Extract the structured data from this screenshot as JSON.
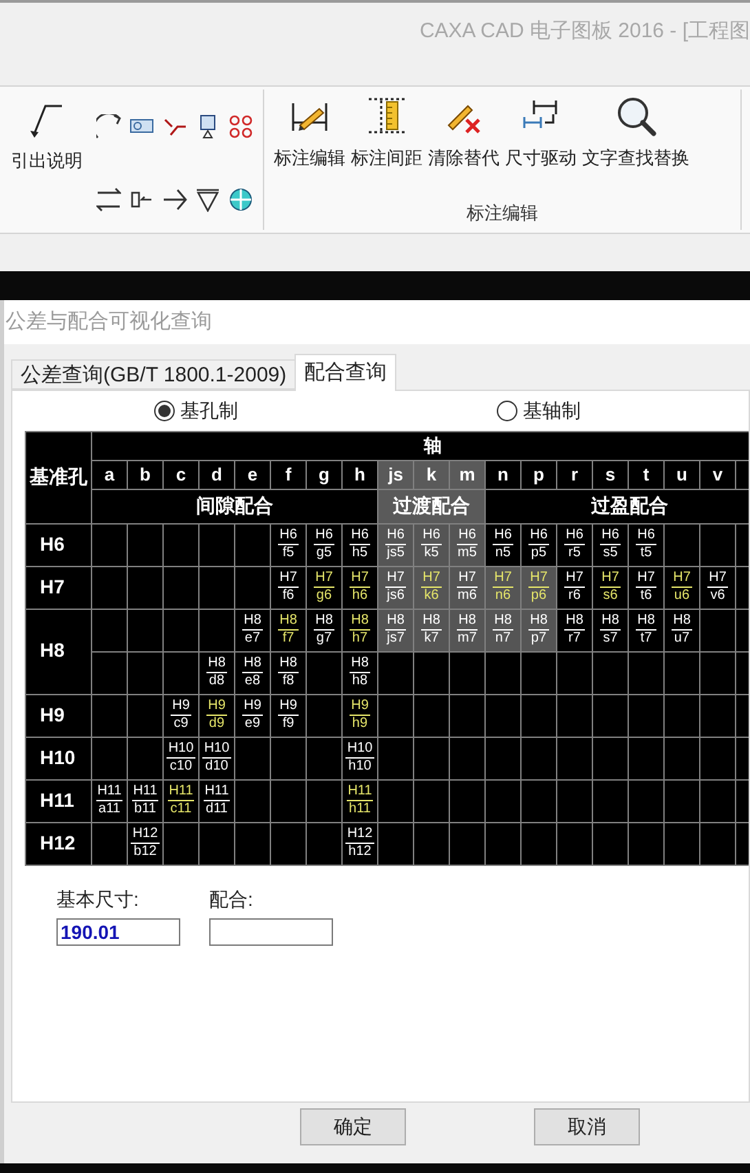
{
  "app_title": "CAXA CAD 电子图板 2016 - [工程图",
  "ribbon": {
    "leader": {
      "label": "引出说明"
    },
    "tools": [
      {
        "label": "标注编辑",
        "kind": "dim-edit"
      },
      {
        "label": "标注间距",
        "kind": "spacing"
      },
      {
        "label": "清除替代",
        "kind": "clear"
      },
      {
        "label": "尺寸驱动",
        "kind": "drive"
      },
      {
        "label": "文字查找替换",
        "kind": "find"
      }
    ],
    "group_label": "标注编辑"
  },
  "dialog": {
    "title": "公差与配合可视化查询",
    "tabs": [
      {
        "label": "公差查询(GB/T 1800.1-2009)",
        "selected": false
      },
      {
        "label": "配合查询",
        "selected": true
      }
    ],
    "radios": [
      {
        "label": "基孔制",
        "selected": true
      },
      {
        "label": "基轴制",
        "selected": false
      }
    ],
    "table": {
      "corner": "基准孔",
      "axis_title": "轴",
      "groups": [
        {
          "label": "间隙配合",
          "shaded": false,
          "columns": [
            "a",
            "b",
            "c",
            "d",
            "e",
            "f",
            "g",
            "h"
          ]
        },
        {
          "label": "过渡配合",
          "shaded": true,
          "columns": [
            "js",
            "k",
            "m"
          ]
        },
        {
          "label": "过盈配合",
          "shaded": false,
          "columns": [
            "n",
            "p",
            "r",
            "s",
            "t",
            "u",
            "v"
          ]
        }
      ],
      "rows": [
        {
          "label": "H6",
          "lines": [
            [
              {
                "kind": "empty"
              },
              {
                "kind": "empty"
              },
              {
                "kind": "empty"
              },
              {
                "kind": "empty"
              },
              {
                "kind": "empty"
              },
              {
                "kind": "fit",
                "top": "H6",
                "bottom": "f5",
                "preferred": false,
                "shaded": false
              },
              {
                "kind": "fit",
                "top": "H6",
                "bottom": "g5",
                "preferred": false,
                "shaded": false
              },
              {
                "kind": "fit",
                "top": "H6",
                "bottom": "h5",
                "preferred": false,
                "shaded": false
              },
              {
                "kind": "fit",
                "top": "H6",
                "bottom": "js5",
                "preferred": false,
                "shaded": true
              },
              {
                "kind": "fit",
                "top": "H6",
                "bottom": "k5",
                "preferred": false,
                "shaded": true
              },
              {
                "kind": "fit",
                "top": "H6",
                "bottom": "m5",
                "preferred": false,
                "shaded": true
              },
              {
                "kind": "fit",
                "top": "H6",
                "bottom": "n5",
                "preferred": false,
                "shaded": false
              },
              {
                "kind": "fit",
                "top": "H6",
                "bottom": "p5",
                "preferred": false,
                "shaded": false
              },
              {
                "kind": "fit",
                "top": "H6",
                "bottom": "r5",
                "preferred": false,
                "shaded": false
              },
              {
                "kind": "fit",
                "top": "H6",
                "bottom": "s5",
                "preferred": false,
                "shaded": false
              },
              {
                "kind": "fit",
                "top": "H6",
                "bottom": "t5",
                "preferred": false,
                "shaded": false
              },
              {
                "kind": "empty"
              },
              {
                "kind": "empty"
              }
            ]
          ]
        },
        {
          "label": "H7",
          "lines": [
            [
              {
                "kind": "empty"
              },
              {
                "kind": "empty"
              },
              {
                "kind": "empty"
              },
              {
                "kind": "empty"
              },
              {
                "kind": "empty"
              },
              {
                "kind": "fit",
                "top": "H7",
                "bottom": "f6",
                "preferred": false,
                "shaded": false
              },
              {
                "kind": "fit",
                "top": "H7",
                "bottom": "g6",
                "preferred": true,
                "shaded": false
              },
              {
                "kind": "fit",
                "top": "H7",
                "bottom": "h6",
                "preferred": true,
                "shaded": false
              },
              {
                "kind": "fit",
                "top": "H7",
                "bottom": "js6",
                "preferred": false,
                "shaded": true
              },
              {
                "kind": "fit",
                "top": "H7",
                "bottom": "k6",
                "preferred": true,
                "shaded": true
              },
              {
                "kind": "fit",
                "top": "H7",
                "bottom": "m6",
                "preferred": false,
                "shaded": true
              },
              {
                "kind": "fit",
                "top": "H7",
                "bottom": "n6",
                "preferred": true,
                "shaded": true
              },
              {
                "kind": "fit",
                "top": "H7",
                "bottom": "p6",
                "preferred": true,
                "shaded": true
              },
              {
                "kind": "fit",
                "top": "H7",
                "bottom": "r6",
                "preferred": false,
                "shaded": false
              },
              {
                "kind": "fit",
                "top": "H7",
                "bottom": "s6",
                "preferred": true,
                "shaded": false
              },
              {
                "kind": "fit",
                "top": "H7",
                "bottom": "t6",
                "preferred": false,
                "shaded": false
              },
              {
                "kind": "fit",
                "top": "H7",
                "bottom": "u6",
                "preferred": true,
                "shaded": false
              },
              {
                "kind": "fit",
                "top": "H7",
                "bottom": "v6",
                "preferred": false,
                "shaded": false
              }
            ]
          ]
        },
        {
          "label": "H8",
          "lines": [
            [
              {
                "kind": "empty"
              },
              {
                "kind": "empty"
              },
              {
                "kind": "empty"
              },
              {
                "kind": "empty"
              },
              {
                "kind": "fit",
                "top": "H8",
                "bottom": "e7",
                "preferred": false,
                "shaded": false
              },
              {
                "kind": "fit",
                "top": "H8",
                "bottom": "f7",
                "preferred": true,
                "shaded": false
              },
              {
                "kind": "fit",
                "top": "H8",
                "bottom": "g7",
                "preferred": false,
                "shaded": false
              },
              {
                "kind": "fit",
                "top": "H8",
                "bottom": "h7",
                "preferred": true,
                "shaded": false
              },
              {
                "kind": "fit",
                "top": "H8",
                "bottom": "js7",
                "preferred": false,
                "shaded": true
              },
              {
                "kind": "fit",
                "top": "H8",
                "bottom": "k7",
                "preferred": false,
                "shaded": true
              },
              {
                "kind": "fit",
                "top": "H8",
                "bottom": "m7",
                "preferred": false,
                "shaded": true
              },
              {
                "kind": "fit",
                "top": "H8",
                "bottom": "n7",
                "preferred": false,
                "shaded": true
              },
              {
                "kind": "fit",
                "top": "H8",
                "bottom": "p7",
                "preferred": false,
                "shaded": true
              },
              {
                "kind": "fit",
                "top": "H8",
                "bottom": "r7",
                "preferred": false,
                "shaded": false
              },
              {
                "kind": "fit",
                "top": "H8",
                "bottom": "s7",
                "preferred": false,
                "shaded": false
              },
              {
                "kind": "fit",
                "top": "H8",
                "bottom": "t7",
                "preferred": false,
                "shaded": false
              },
              {
                "kind": "fit",
                "top": "H8",
                "bottom": "u7",
                "preferred": false,
                "shaded": false
              },
              {
                "kind": "empty"
              }
            ],
            [
              {
                "kind": "empty"
              },
              {
                "kind": "empty"
              },
              {
                "kind": "empty"
              },
              {
                "kind": "fit",
                "top": "H8",
                "bottom": "d8",
                "preferred": false,
                "shaded": false
              },
              {
                "kind": "fit",
                "top": "H8",
                "bottom": "e8",
                "preferred": false,
                "shaded": false
              },
              {
                "kind": "fit",
                "top": "H8",
                "bottom": "f8",
                "preferred": false,
                "shaded": false
              },
              {
                "kind": "empty"
              },
              {
                "kind": "fit",
                "top": "H8",
                "bottom": "h8",
                "preferred": false,
                "shaded": false
              },
              {
                "kind": "empty"
              },
              {
                "kind": "empty"
              },
              {
                "kind": "empty"
              },
              {
                "kind": "empty"
              },
              {
                "kind": "empty"
              },
              {
                "kind": "empty"
              },
              {
                "kind": "empty"
              },
              {
                "kind": "empty"
              },
              {
                "kind": "empty"
              },
              {
                "kind": "empty"
              }
            ]
          ]
        },
        {
          "label": "H9",
          "lines": [
            [
              {
                "kind": "empty"
              },
              {
                "kind": "empty"
              },
              {
                "kind": "fit",
                "top": "H9",
                "bottom": "c9",
                "preferred": false,
                "shaded": false
              },
              {
                "kind": "fit",
                "top": "H9",
                "bottom": "d9",
                "preferred": true,
                "shaded": false
              },
              {
                "kind": "fit",
                "top": "H9",
                "bottom": "e9",
                "preferred": false,
                "shaded": false
              },
              {
                "kind": "fit",
                "top": "H9",
                "bottom": "f9",
                "preferred": false,
                "shaded": false
              },
              {
                "kind": "empty"
              },
              {
                "kind": "fit",
                "top": "H9",
                "bottom": "h9",
                "preferred": true,
                "shaded": false
              },
              {
                "kind": "empty"
              },
              {
                "kind": "empty"
              },
              {
                "kind": "empty"
              },
              {
                "kind": "empty"
              },
              {
                "kind": "empty"
              },
              {
                "kind": "empty"
              },
              {
                "kind": "empty"
              },
              {
                "kind": "empty"
              },
              {
                "kind": "empty"
              },
              {
                "kind": "empty"
              }
            ]
          ]
        },
        {
          "label": "H10",
          "lines": [
            [
              {
                "kind": "empty"
              },
              {
                "kind": "empty"
              },
              {
                "kind": "fit",
                "top": "H10",
                "bottom": "c10",
                "preferred": false,
                "shaded": false
              },
              {
                "kind": "fit",
                "top": "H10",
                "bottom": "d10",
                "preferred": false,
                "shaded": false
              },
              {
                "kind": "empty"
              },
              {
                "kind": "empty"
              },
              {
                "kind": "empty"
              },
              {
                "kind": "fit",
                "top": "H10",
                "bottom": "h10",
                "preferred": false,
                "shaded": false
              },
              {
                "kind": "empty"
              },
              {
                "kind": "empty"
              },
              {
                "kind": "empty"
              },
              {
                "kind": "empty"
              },
              {
                "kind": "empty"
              },
              {
                "kind": "empty"
              },
              {
                "kind": "empty"
              },
              {
                "kind": "empty"
              },
              {
                "kind": "empty"
              },
              {
                "kind": "empty"
              }
            ]
          ]
        },
        {
          "label": "H11",
          "lines": [
            [
              {
                "kind": "fit",
                "top": "H11",
                "bottom": "a11",
                "preferred": false,
                "shaded": false
              },
              {
                "kind": "fit",
                "top": "H11",
                "bottom": "b11",
                "preferred": false,
                "shaded": false
              },
              {
                "kind": "fit",
                "top": "H11",
                "bottom": "c11",
                "preferred": true,
                "shaded": false
              },
              {
                "kind": "fit",
                "top": "H11",
                "bottom": "d11",
                "preferred": false,
                "shaded": false
              },
              {
                "kind": "empty"
              },
              {
                "kind": "empty"
              },
              {
                "kind": "empty"
              },
              {
                "kind": "fit",
                "top": "H11",
                "bottom": "h11",
                "preferred": true,
                "shaded": false
              },
              {
                "kind": "empty"
              },
              {
                "kind": "empty"
              },
              {
                "kind": "empty"
              },
              {
                "kind": "empty"
              },
              {
                "kind": "empty"
              },
              {
                "kind": "empty"
              },
              {
                "kind": "empty"
              },
              {
                "kind": "empty"
              },
              {
                "kind": "empty"
              },
              {
                "kind": "empty"
              }
            ]
          ]
        },
        {
          "label": "H12",
          "lines": [
            [
              {
                "kind": "empty"
              },
              {
                "kind": "fit",
                "top": "H12",
                "bottom": "b12",
                "preferred": false,
                "shaded": false
              },
              {
                "kind": "empty"
              },
              {
                "kind": "empty"
              },
              {
                "kind": "empty"
              },
              {
                "kind": "empty"
              },
              {
                "kind": "empty"
              },
              {
                "kind": "fit",
                "top": "H12",
                "bottom": "h12",
                "preferred": false,
                "shaded": false
              },
              {
                "kind": "empty"
              },
              {
                "kind": "empty"
              },
              {
                "kind": "empty"
              },
              {
                "kind": "empty"
              },
              {
                "kind": "empty"
              },
              {
                "kind": "empty"
              },
              {
                "kind": "empty"
              },
              {
                "kind": "empty"
              },
              {
                "kind": "empty"
              },
              {
                "kind": "empty"
              }
            ]
          ]
        }
      ]
    },
    "fields": [
      {
        "label": "基本尺寸:",
        "value": "190.01"
      },
      {
        "label": "配合:"
      }
    ],
    "buttons": [
      "确定",
      "取消"
    ]
  }
}
